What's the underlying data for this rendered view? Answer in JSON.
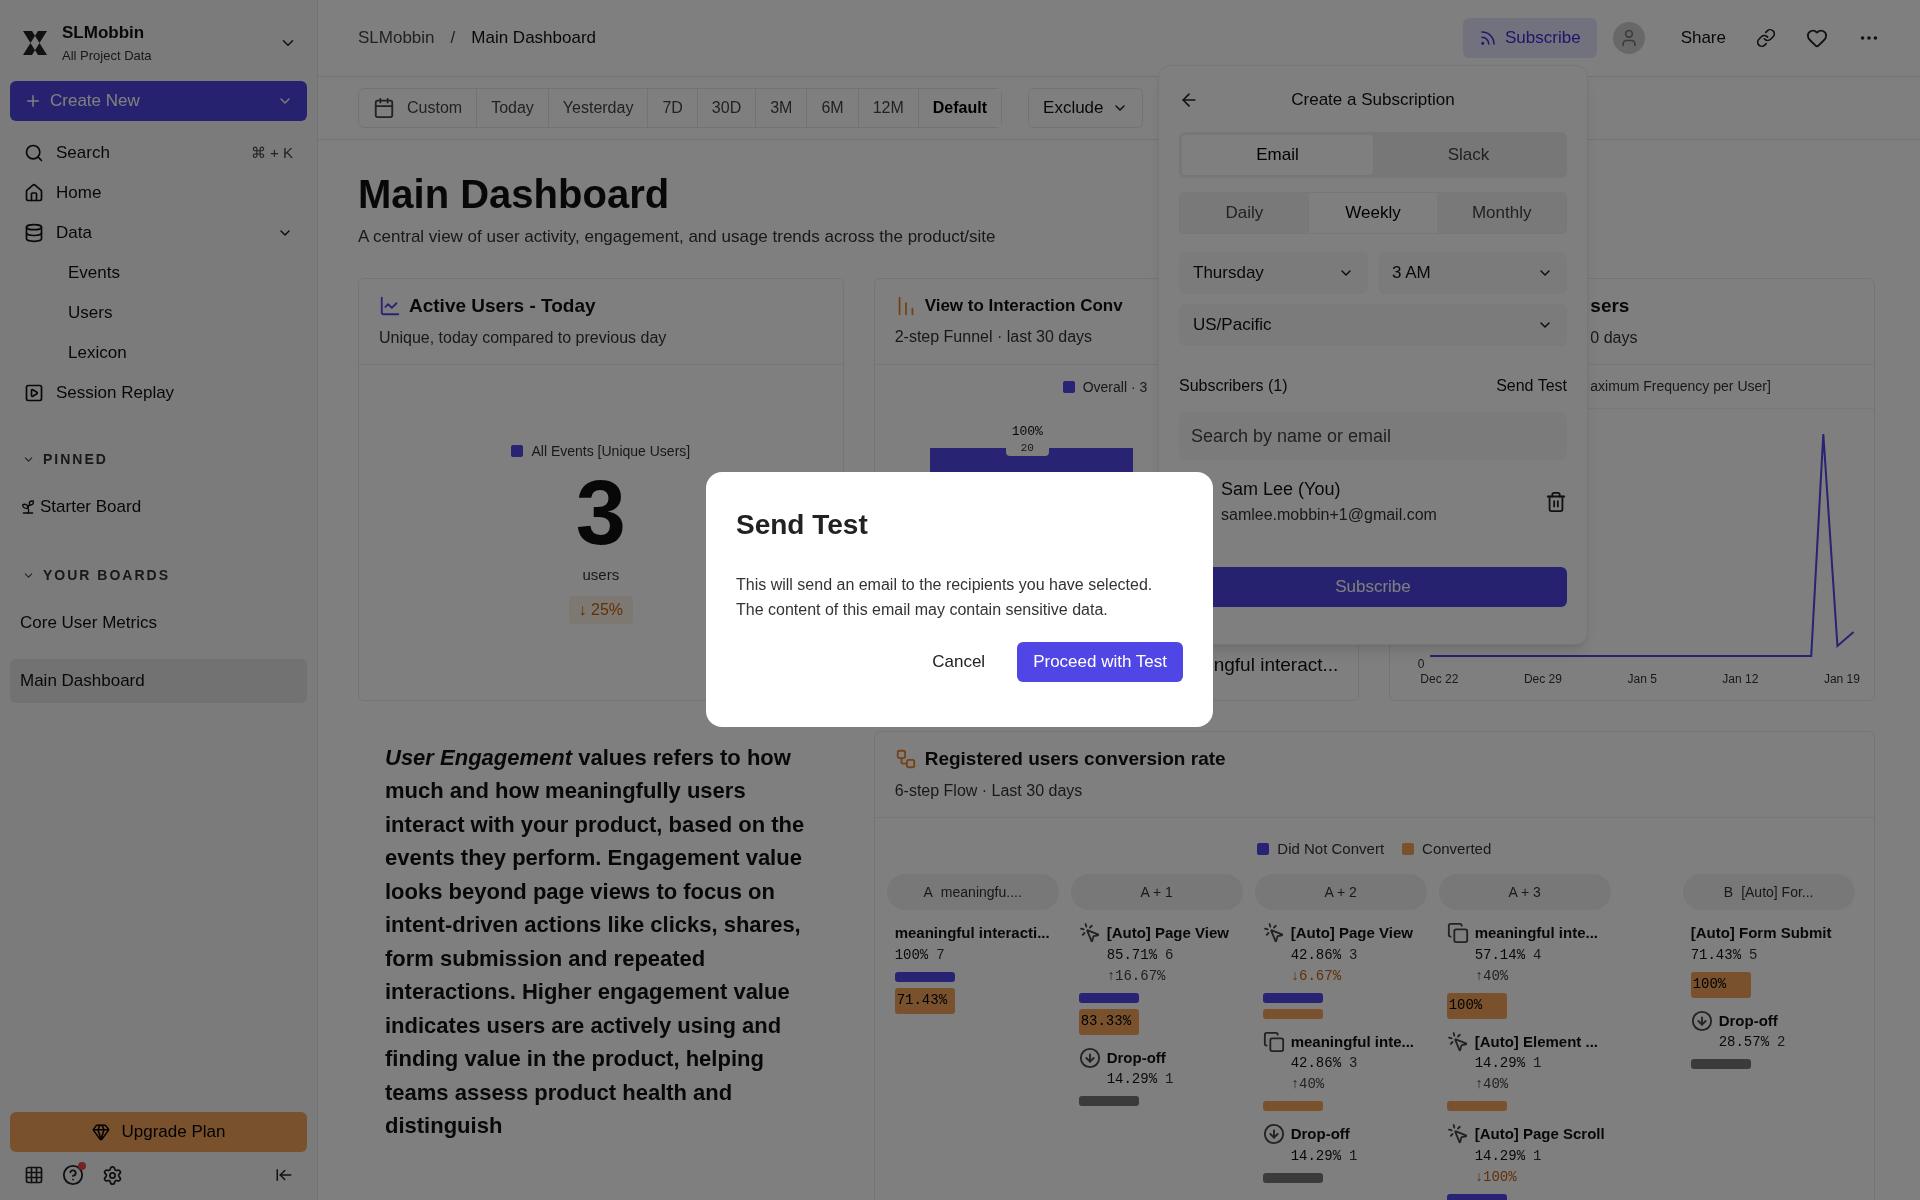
{
  "sidebar": {
    "workspace": {
      "name": "SLMobbin",
      "subtitle": "All Project Data"
    },
    "create_button": "Create New",
    "search": {
      "label": "Search",
      "shortcut": "⌘ + K"
    },
    "nav": [
      {
        "label": "Home",
        "kind": "home"
      },
      {
        "label": "Data",
        "kind": "data",
        "expanded": true,
        "children": [
          {
            "label": "Events"
          },
          {
            "label": "Users"
          },
          {
            "label": "Lexicon"
          }
        ]
      },
      {
        "label": "Session Replay",
        "kind": "replay"
      }
    ],
    "sections": [
      {
        "title": "PINNED",
        "expanded": true,
        "items": [
          {
            "label": "Starter Board",
            "kind": "sprout",
            "selected": false
          }
        ]
      },
      {
        "title": "YOUR BOARDS",
        "expanded": true,
        "items": [
          {
            "label": "Core User Metrics",
            "kind": "plain",
            "selected": false
          },
          {
            "label": "Main Dashboard",
            "kind": "plain",
            "selected": true
          }
        ]
      }
    ],
    "upgrade_button": "Upgrade Plan",
    "help_notification": true
  },
  "header": {
    "breadcrumb": [
      "SLMobbin",
      "Main Dashboard"
    ],
    "separator": "/",
    "subscribe": "Subscribe",
    "share": "Share"
  },
  "date_filters": [
    {
      "label": "Custom",
      "kind": "calendar",
      "selected": false
    },
    {
      "label": "Today",
      "kind": "plain",
      "selected": false
    },
    {
      "label": "Yesterday",
      "kind": "plain",
      "selected": false
    },
    {
      "label": "7D",
      "kind": "plain",
      "selected": false
    },
    {
      "label": "30D",
      "kind": "plain",
      "selected": false
    },
    {
      "label": "3M",
      "kind": "plain",
      "selected": false
    },
    {
      "label": "6M",
      "kind": "plain",
      "selected": false
    },
    {
      "label": "12M",
      "kind": "plain",
      "selected": false
    },
    {
      "label": "Default",
      "kind": "plain",
      "selected": true
    }
  ],
  "exclude": "Exclude",
  "dashboard": {
    "title": "Main Dashboard",
    "description": "A central view of user activity, engagement, and usage trends across the product/site"
  },
  "active_users_card": {
    "title": "Active Users - Today",
    "subtitle": "Unique, today compared to previous day",
    "legend": "All Events [Unique Users]",
    "value": "3",
    "unit": "users",
    "change": "↓ 25%",
    "negative": true
  },
  "funnel_card": {
    "title": "View to Interaction Conv",
    "subtitle": "2-step Funnel · last 30 days",
    "legend": "Overall · 3",
    "bar_percent": "100%",
    "bar_count": "20",
    "footer": "ngful interact..."
  },
  "frequency_card": {
    "title": "sers",
    "subtitle": "0 days",
    "legend": "aximum Frequency per User]",
    "y_tick": "0",
    "x_labels": [
      "Dec 22",
      "Dec 29",
      "Jan 5",
      "Jan 12",
      "Jan 19"
    ]
  },
  "text_block": "*User Engagement* values refers to how much and how meaningfully users interact with your product, based on the events they perform. Engagement value looks beyond page views to focus on intent-driven actions like clicks, shares, form submission and repeated interactions. Higher engagement value indicates users are actively using and finding value in the product, helping teams assess product health and distinguish",
  "flow_card": {
    "title": "Registered users conversion rate",
    "subtitle": "6-step Flow · Last 30 days",
    "legend": [
      {
        "label": "Did Not Convert",
        "kind": "not_converted"
      },
      {
        "label": "Converted",
        "kind": "converted"
      }
    ],
    "columns": [
      {
        "kind": "step",
        "header": {
          "letter": "A",
          "label": "meaningfu...."
        },
        "nodes": [
          {
            "kind": "plain",
            "name": "meaningful interacti...",
            "percent": "100%",
            "count": "7",
            "bars": [
              {
                "kind": "not_converted"
              },
              {
                "kind": "converted",
                "label": "71.43%"
              }
            ]
          }
        ]
      },
      {
        "kind": "step",
        "header": {
          "label": "A + 1"
        },
        "nodes": [
          {
            "kind": "cursor",
            "name": "[Auto] Page View",
            "percent": "85.71%",
            "count": "6",
            "change": "↑16.67%",
            "negative": false,
            "bars": [
              {
                "kind": "not_converted"
              },
              {
                "kind": "converted",
                "label": "83.33%"
              }
            ]
          },
          {
            "kind": "dropoff",
            "name": "Drop-off",
            "percent": "14.29%",
            "count": "1",
            "bars": [
              {
                "kind": "dropoff"
              }
            ]
          }
        ]
      },
      {
        "kind": "step",
        "header": {
          "label": "A + 2"
        },
        "nodes": [
          {
            "kind": "cursor",
            "name": "[Auto] Page View",
            "percent": "42.86%",
            "count": "3",
            "change": "↓6.67%",
            "negative": true,
            "bars": [
              {
                "kind": "not_converted"
              },
              {
                "kind": "converted"
              }
            ]
          },
          {
            "kind": "copy",
            "name": "meaningful inte...",
            "percent": "42.86%",
            "count": "3",
            "change": "↑40%",
            "negative": false,
            "bars": [
              {
                "kind": "converted"
              }
            ]
          },
          {
            "kind": "dropoff",
            "name": "Drop-off",
            "percent": "14.29%",
            "count": "1",
            "bars": [
              {
                "kind": "dropoff"
              }
            ]
          }
        ]
      },
      {
        "kind": "step",
        "header": {
          "label": "A + 3"
        },
        "nodes": [
          {
            "kind": "copy",
            "name": "meaningful inte...",
            "percent": "57.14%",
            "count": "4",
            "change": "↑40%",
            "negative": false,
            "bars": [
              {
                "kind": "converted",
                "label": "100%"
              }
            ]
          },
          {
            "kind": "cursor",
            "name": "[Auto] Element ...",
            "percent": "14.29%",
            "count": "1",
            "change": "↑40%",
            "negative": false,
            "bars": [
              {
                "kind": "converted"
              }
            ]
          },
          {
            "kind": "cursor",
            "name": "[Auto] Page Scroll",
            "percent": "14.29%",
            "count": "1",
            "change": "↓100%",
            "negative": true,
            "bars": [
              {
                "kind": "not_converted"
              }
            ]
          }
        ]
      },
      {
        "kind": "target",
        "header": {
          "letter": "B",
          "label": "[Auto] For..."
        },
        "nodes": [
          {
            "kind": "plain",
            "name": "[Auto] Form Submit",
            "percent": "71.43%",
            "count": "5",
            "bars": [
              {
                "kind": "converted",
                "label": "100%"
              }
            ]
          },
          {
            "kind": "dropoff",
            "name": "Drop-off",
            "percent": "28.57%",
            "count": "2",
            "bars": [
              {
                "kind": "dropoff"
              }
            ]
          }
        ]
      }
    ]
  },
  "subscription_panel": {
    "title": "Create a Subscription",
    "channels": [
      {
        "label": "Email",
        "selected": true
      },
      {
        "label": "Slack",
        "selected": false
      }
    ],
    "frequencies": [
      {
        "label": "Daily",
        "selected": false
      },
      {
        "label": "Weekly",
        "selected": true
      },
      {
        "label": "Monthly",
        "selected": false
      }
    ],
    "day": "Thursday",
    "time": "3 AM",
    "timezone": "US/Pacific",
    "subscribers_label": "Subscribers (1)",
    "send_test": "Send Test",
    "search": {
      "placeholder": "Search by name or email"
    },
    "subscribers": [
      {
        "name": "Sam Lee (You)",
        "email": "samlee.mobbin+1@gmail.com"
      }
    ],
    "subscribe_button": "Subscribe"
  },
  "dialog": {
    "title": "Send Test",
    "body": "This will send an email to the recipients you have selected. The content of this email may contain sensitive data.",
    "cancel": "Cancel",
    "confirm": "Proceed with Test"
  }
}
